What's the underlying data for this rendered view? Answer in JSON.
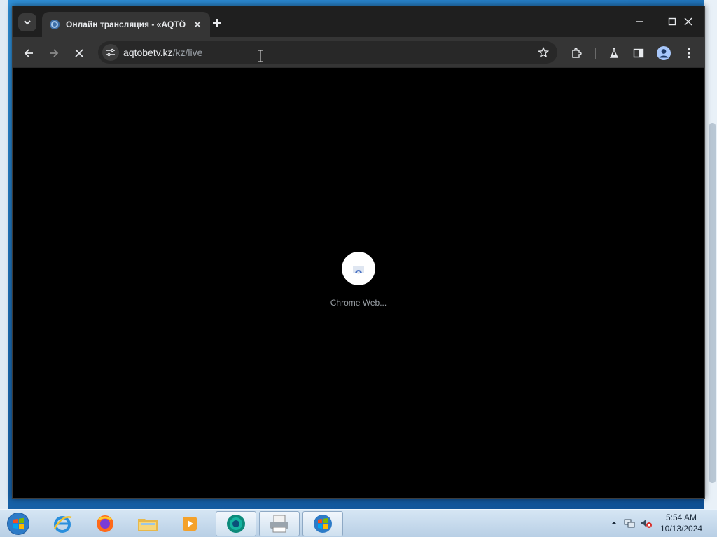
{
  "browser": {
    "tab": {
      "title": "Онлайн трансляция - «AQTÖ",
      "close_icon": "close-icon",
      "favicon": "channel-logo-icon"
    },
    "new_tab_icon": "plus-icon",
    "window_controls": [
      "minimize-icon",
      "maximize-icon",
      "close-icon"
    ],
    "toolbar": {
      "back_icon": "arrow-left-icon",
      "forward_icon": "arrow-right-icon",
      "stop_icon": "stop-icon",
      "url_host": "aqtobetv.kz",
      "url_path": "/kz/live",
      "bookmark_icon": "star-icon",
      "extensions_icon": "puzzle-icon",
      "labs_icon": "flask-icon",
      "side_panel_icon": "side-panel-icon",
      "profile_icon": "profile-icon",
      "menu_icon": "kebab-menu-icon"
    },
    "content": {
      "loading_app_label": "Chrome Web..."
    }
  },
  "taskbar": {
    "items": [
      "start-orb-icon",
      "internet-explorer-icon",
      "firefox-icon",
      "file-explorer-icon",
      "media-player-icon",
      "chrome-icon",
      "printer-icon",
      "windows-icon"
    ],
    "clock": {
      "time": "5:54 AM",
      "date": "10/13/2024"
    }
  },
  "colors": {
    "tab_strip": "#1f1f1f",
    "toolbar": "#353535",
    "content": "#000000",
    "taskbar": "#c6dbee"
  }
}
